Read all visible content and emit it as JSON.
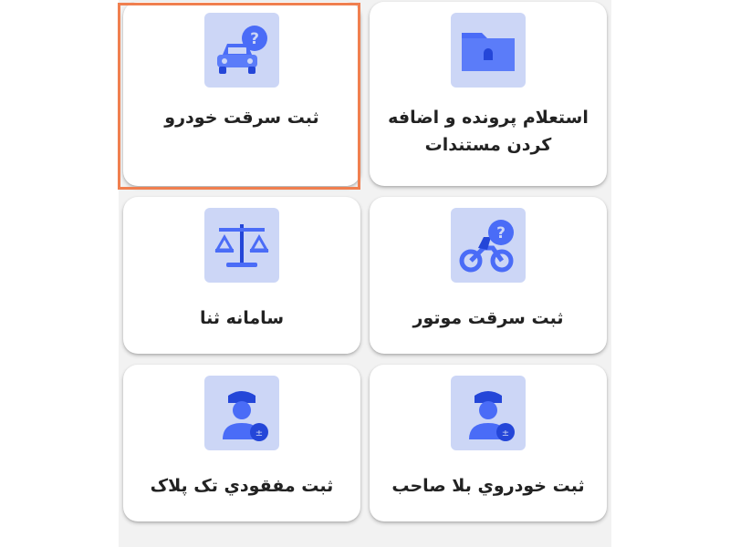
{
  "colors": {
    "tile_bg": "#ccd6f6",
    "icon_blue": "#4a6cf7",
    "icon_dark": "#2446d8",
    "highlight": "#f07f4f"
  },
  "cards": [
    {
      "label": "استعلام پرونده و اضافه کردن مستندات",
      "icon": "folder-lock-icon"
    },
    {
      "label": "ثبت سرقت خودرو",
      "icon": "car-question-icon"
    },
    {
      "label": "ثبت سرقت موتور",
      "icon": "motorcycle-question-icon"
    },
    {
      "label": "سامانه ثنا",
      "icon": "scales-icon"
    },
    {
      "label": "ثبت خودروي بلا صاحب",
      "icon": "police-officer-badge-icon"
    },
    {
      "label": "ثبت مفقودي تک پلاک",
      "icon": "police-officer-badge-icon"
    }
  ]
}
